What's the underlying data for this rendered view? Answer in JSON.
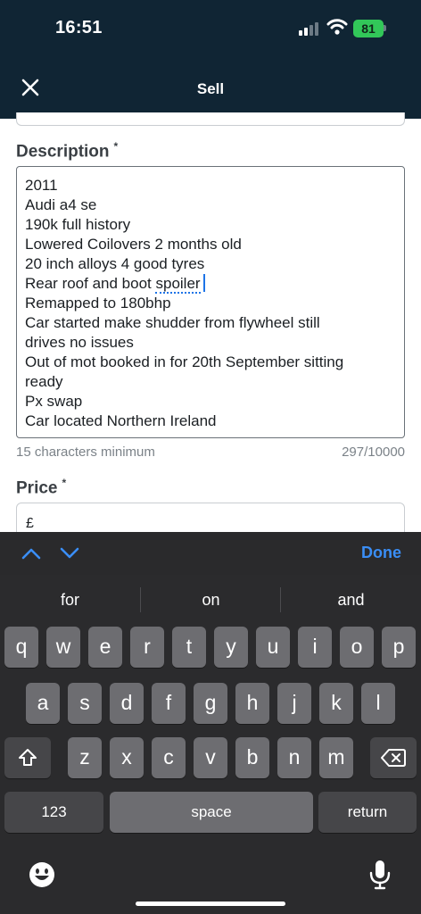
{
  "status_bar": {
    "time": "16:51",
    "battery": "81"
  },
  "header": {
    "title": "Sell"
  },
  "description": {
    "label": "Description",
    "required_mark": "*",
    "lines": [
      "2011",
      "Audi a4 se",
      "190k full history",
      "Lowered Coilovers 2 months old",
      "20 inch alloys 4 good tyres",
      "Rear roof and boot ",
      "Remapped to 180bhp",
      "Car started make shudder from flywheel still",
      "drives no issues",
      "Out of mot booked in for 20th September sitting",
      "ready",
      "Px swap",
      "Car located Northern Ireland"
    ],
    "spellcheck_word": "spoiler",
    "hint": "15 characters minimum",
    "counter": "297/10000"
  },
  "price": {
    "label": "Price",
    "required_mark": "*",
    "value": "£"
  },
  "accessory": {
    "done_label": "Done"
  },
  "keyboard": {
    "suggestions": [
      "for",
      "on",
      "and"
    ],
    "row1": [
      "q",
      "w",
      "e",
      "r",
      "t",
      "y",
      "u",
      "i",
      "o",
      "p"
    ],
    "row2": [
      "a",
      "s",
      "d",
      "f",
      "g",
      "h",
      "j",
      "k",
      "l"
    ],
    "row3": [
      "z",
      "x",
      "c",
      "v",
      "b",
      "n",
      "m"
    ],
    "numbers_label": "123",
    "space_label": "space",
    "return_label": "return"
  },
  "colors": {
    "header_bg": "#102534",
    "accent": "#3a8ef6",
    "battery": "#32c759",
    "cursor": "#1d74e7"
  }
}
